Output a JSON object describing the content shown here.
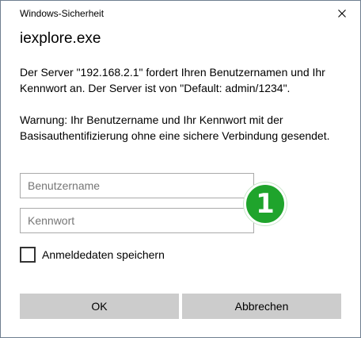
{
  "window": {
    "title": "Windows-Sicherheit",
    "close_icon": "close-icon"
  },
  "app_name": "iexplore.exe",
  "message": {
    "paragraph_1": "Der Server \"192.168.2.1\" fordert Ihren Benutzernamen und Ihr Kennwort an. Der Server ist von \"Default: admin/1234\".",
    "paragraph_2": "Warnung: Ihr Benutzername und Ihr Kennwort mit der Basisauthentifizierung ohne eine sichere Verbindung gesendet."
  },
  "form": {
    "username": {
      "placeholder": "Benutzername",
      "value": ""
    },
    "password": {
      "placeholder": "Kennwort",
      "value": ""
    },
    "remember": {
      "label": "Anmeldedaten speichern",
      "checked": false
    }
  },
  "callout": {
    "number": "1",
    "color": "#1fa42c"
  },
  "buttons": {
    "ok_label": "OK",
    "cancel_label": "Abbrechen"
  }
}
